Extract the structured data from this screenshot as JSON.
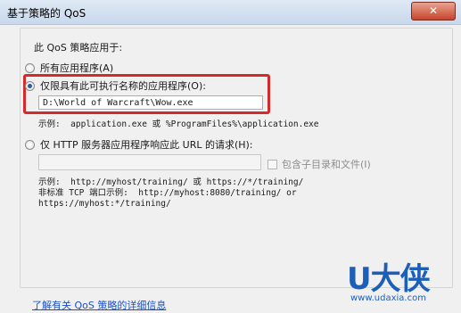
{
  "window": {
    "title": "基于策略的 QoS",
    "close_glyph": "✕"
  },
  "section": {
    "heading": "此 QoS 策略应用于:"
  },
  "options": {
    "all_apps": "所有应用程序(A)",
    "specific_exe": "仅限具有此可执行名称的应用程序(O):",
    "exe_path_value": "D:\\World of Warcraft\\Wow.exe",
    "exe_example": "示例:  application.exe 或 %ProgramFiles%\\application.exe",
    "http_url": "仅 HTTP 服务器应用程序响应此 URL 的请求(H):",
    "url_value": "",
    "include_subdirs": "包含子目录和文件(I)",
    "url_example_line1": "示例:  http://myhost/training/ 或 https://*/training/",
    "url_example_line2": "非标准 TCP 端口示例:  http://myhost:8080/training/ or",
    "url_example_line3": "https://myhost:*/training/"
  },
  "footer": {
    "learn_more_link": "了解有关 QoS 策略的详细信息"
  },
  "watermark": {
    "brand": "U大侠",
    "url": "www.udaxia.com"
  },
  "colors": {
    "highlight_border": "#d42a2a",
    "link": "#1a52c8",
    "watermark": "#1d5fb8",
    "close_button": "#c8452c"
  }
}
